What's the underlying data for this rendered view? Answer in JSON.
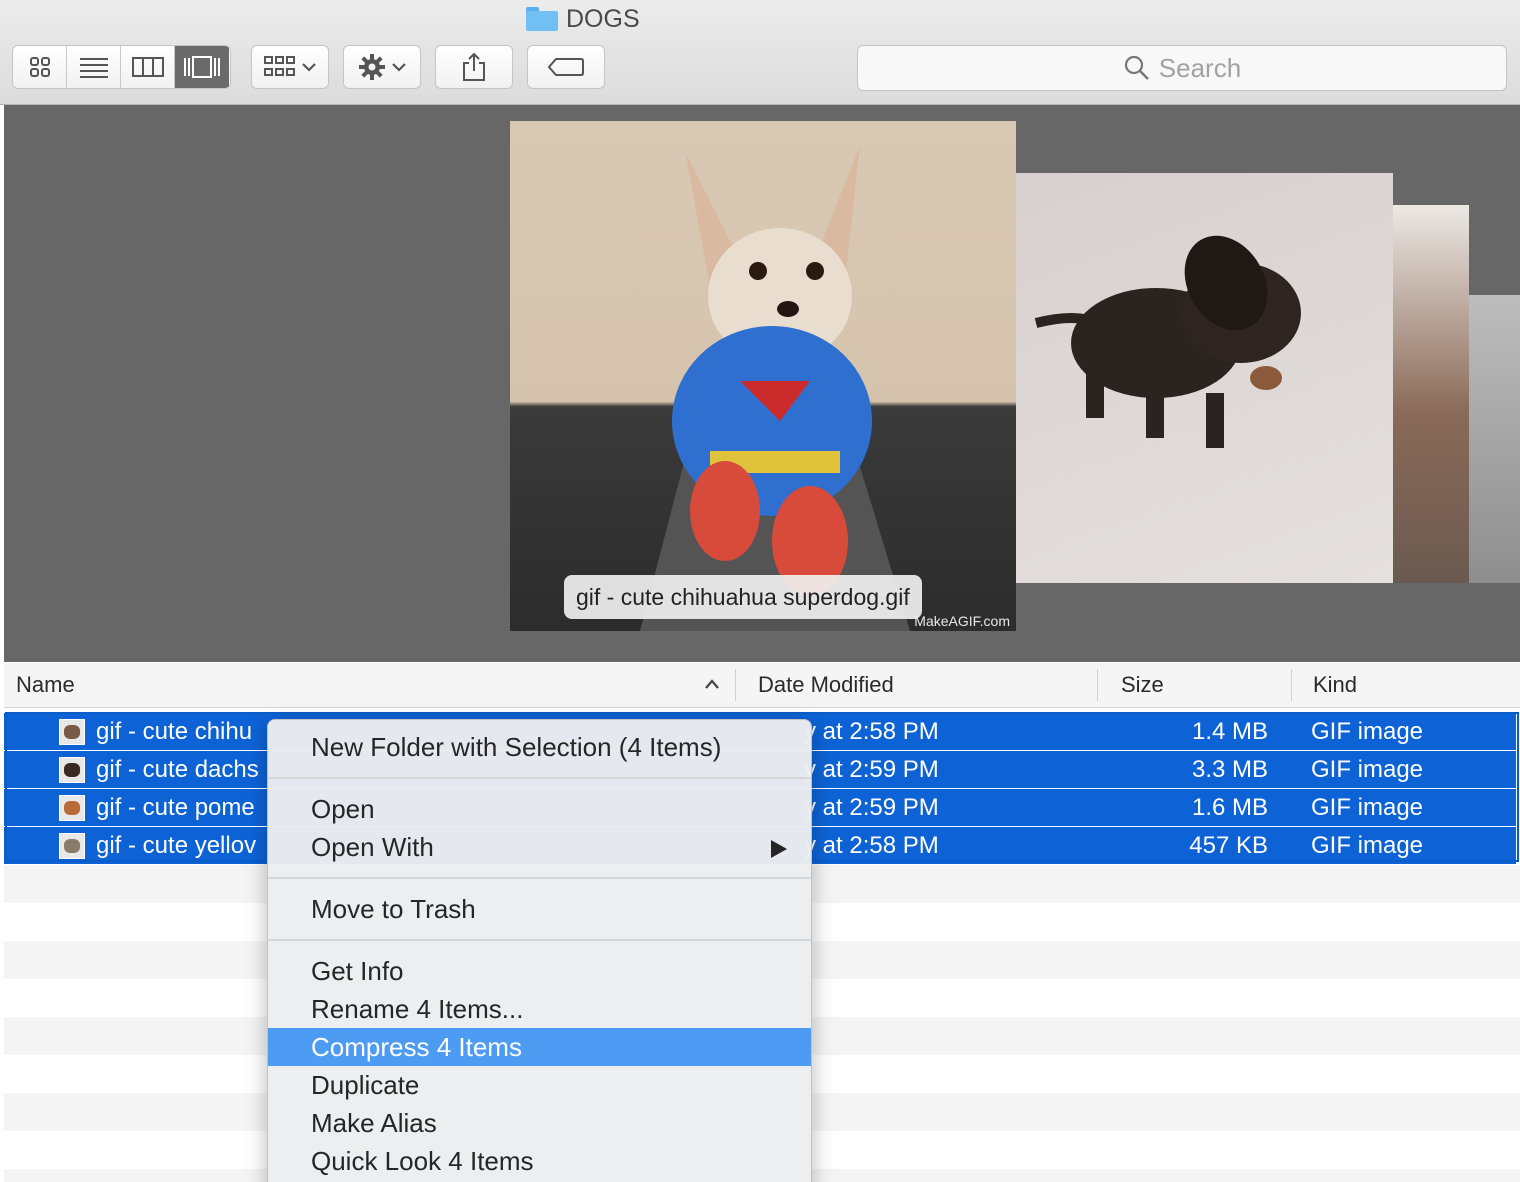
{
  "window": {
    "title": "DOGS"
  },
  "toolbar": {
    "view_modes": [
      {
        "id": "icon-view",
        "icon": "grid-icon",
        "active": false
      },
      {
        "id": "list-view",
        "icon": "list-icon",
        "active": false
      },
      {
        "id": "column-view",
        "icon": "columns-icon",
        "active": false
      },
      {
        "id": "cover-flow-view",
        "icon": "cover-flow-icon",
        "active": true
      }
    ],
    "arrange_icon": "arrange-grid-icon",
    "action_icon": "gear-icon",
    "share_icon": "share-icon",
    "tags_icon": "tag-icon"
  },
  "search": {
    "placeholder": "Search"
  },
  "coverflow": {
    "caption": "gif - cute chihuahua superdog.gif",
    "watermark": "MakeAGIF.com"
  },
  "list": {
    "columns": {
      "name": "Name",
      "date_modified": "Date Modified",
      "size": "Size",
      "kind": "Kind"
    },
    "sort_indicator": "chevron-up-icon",
    "rows": [
      {
        "name": "gif - cute chihu",
        "date": "y at 2:58 PM",
        "size": "1.4 MB",
        "kind": "GIF image",
        "selected": true
      },
      {
        "name": "gif - cute dachs",
        "date": "y at 2:59 PM",
        "size": "3.3 MB",
        "kind": "GIF image",
        "selected": true
      },
      {
        "name": "gif - cute pome",
        "date": "y at 2:59 PM",
        "size": "1.6 MB",
        "kind": "GIF image",
        "selected": true
      },
      {
        "name": "gif - cute yellov",
        "date": "y at 2:58 PM",
        "size": "457 KB",
        "kind": "GIF image",
        "selected": true
      }
    ]
  },
  "context_menu": {
    "items": [
      {
        "label": "New Folder with Selection (4 Items)"
      },
      {
        "label": "Open"
      },
      {
        "label": "Open With",
        "submenu": true
      },
      {
        "label": "Move to Trash"
      },
      {
        "label": "Get Info"
      },
      {
        "label": "Rename 4 Items..."
      },
      {
        "label": "Compress 4 Items",
        "highlighted": true
      },
      {
        "label": "Duplicate"
      },
      {
        "label": "Make Alias"
      },
      {
        "label": "Quick Look 4 Items"
      }
    ]
  },
  "colors": {
    "selection": "#0d63d6",
    "menu_highlight": "#4d9bf3",
    "folder": "#72bff3",
    "coverflow_bg": "#676767"
  }
}
